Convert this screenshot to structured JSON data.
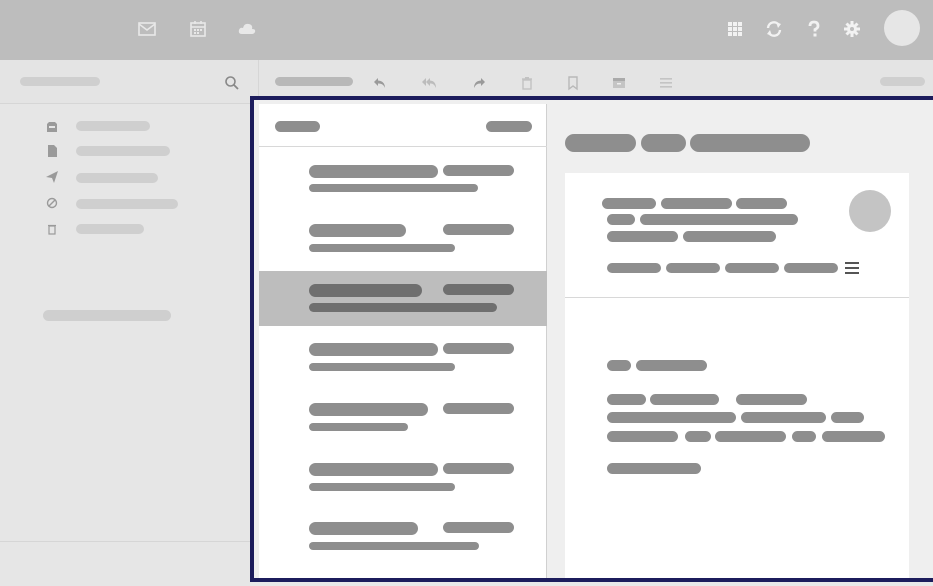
{
  "app": {
    "colors": {
      "topbar": "#bdbdbd",
      "focus_frame": "#1c1c5c",
      "selected_row": "#bdbdbd",
      "skeleton": "#8e8e8e"
    }
  },
  "topbar": {
    "icons": [
      "mail-icon",
      "calendar-icon",
      "cloud-icon",
      "apps-grid-icon",
      "refresh-icon",
      "help-icon",
      "settings-icon",
      "avatar"
    ]
  },
  "toolbar": {
    "icons": [
      "reply-icon",
      "reply-all-icon",
      "forward-icon",
      "trash-icon",
      "bookmark-icon",
      "archive-icon",
      "more-menu-icon"
    ]
  },
  "sidebar": {
    "icons": [
      "inbox-icon",
      "draft-icon",
      "sent-icon",
      "spam-icon",
      "trash-icon"
    ]
  },
  "message_list": {
    "selected_index": 2,
    "item_count": 7
  },
  "reader": {
    "menu_icon": "menu-icon"
  }
}
